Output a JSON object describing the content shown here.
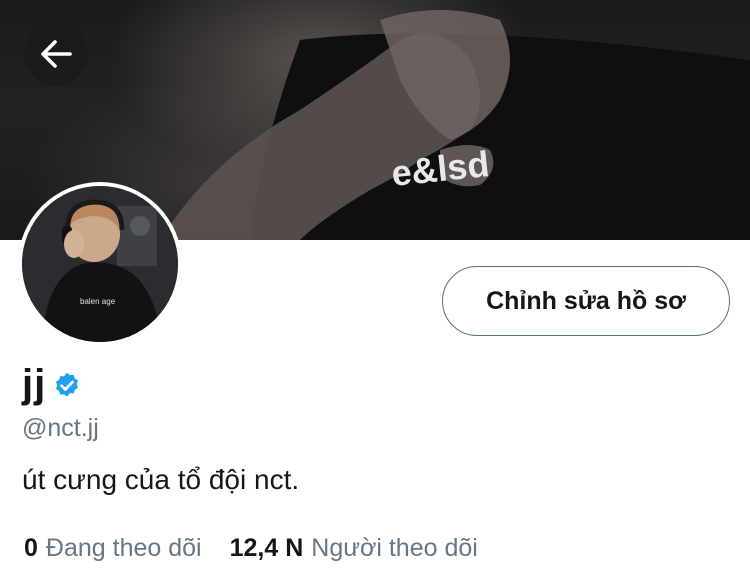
{
  "header": {
    "back_icon": "arrow-left-icon"
  },
  "profile": {
    "edit_button_label": "Chỉnh sửa hồ sơ",
    "display_name": "jj",
    "verified_icon": "verified-badge-icon",
    "verified_color": "#1da1f2",
    "handle": "@nct.jj",
    "bio": "út cưng của tổ đội nct."
  },
  "stats": {
    "following_count": "0",
    "following_label": "Đang theo dõi",
    "followers_count": "12,4 N",
    "followers_label": "Người theo dõi"
  },
  "banner": {
    "shirt_text": "e&lsd"
  },
  "avatar": {
    "shirt_text": "balen age"
  }
}
